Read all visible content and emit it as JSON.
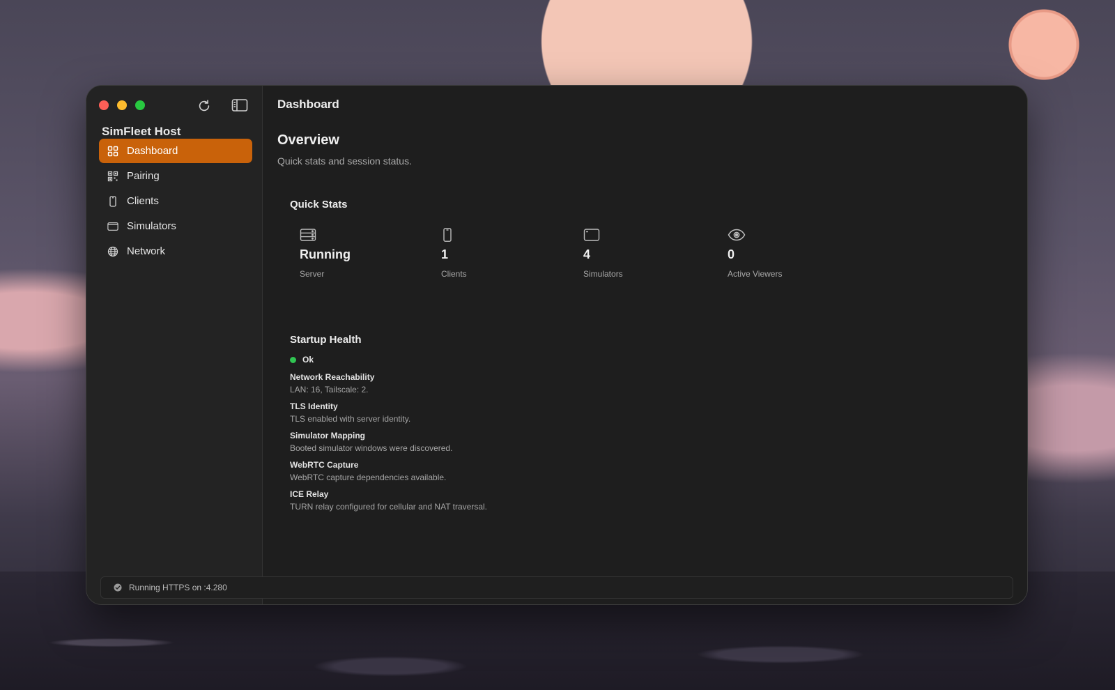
{
  "window": {
    "main_title": "Dashboard"
  },
  "sidebar": {
    "app_name": "SimFleet Host",
    "items": [
      {
        "label": "Dashboard",
        "icon": "grid-icon",
        "active": true
      },
      {
        "label": "Pairing",
        "icon": "qr-code-icon",
        "active": false
      },
      {
        "label": "Clients",
        "icon": "phone-icon",
        "active": false
      },
      {
        "label": "Simulators",
        "icon": "window-icon",
        "active": false
      },
      {
        "label": "Network",
        "icon": "globe-icon",
        "active": false
      }
    ]
  },
  "overview": {
    "title": "Overview",
    "subtitle": "Quick stats and session status."
  },
  "quick_stats": {
    "title": "Quick Stats",
    "items": [
      {
        "value": "Running",
        "label": "Server",
        "icon": "server-icon"
      },
      {
        "value": "1",
        "label": "Clients",
        "icon": "phone-icon"
      },
      {
        "value": "4",
        "label": "Simulators",
        "icon": "window-icon"
      },
      {
        "value": "0",
        "label": "Active Viewers",
        "icon": "eye-icon"
      }
    ]
  },
  "startup_health": {
    "title": "Startup Health",
    "status": "Ok",
    "status_color": "#30c552",
    "checks": [
      {
        "title": "Network Reachability",
        "desc": "LAN: 16, Tailscale: 2."
      },
      {
        "title": "TLS Identity",
        "desc": "TLS enabled with server identity."
      },
      {
        "title": "Simulator Mapping",
        "desc": "Booted simulator windows were discovered."
      },
      {
        "title": "WebRTC Capture",
        "desc": "WebRTC capture dependencies available."
      },
      {
        "title": "ICE Relay",
        "desc": "TURN relay configured for cellular and NAT traversal."
      }
    ]
  },
  "status_bar": {
    "text": "Running HTTPS on :4.280",
    "icon": "checkmark-circle-icon"
  },
  "colors": {
    "accent": "#c9620a",
    "window_bg": "#1e1e1e",
    "sidebar_bg": "#232323"
  }
}
